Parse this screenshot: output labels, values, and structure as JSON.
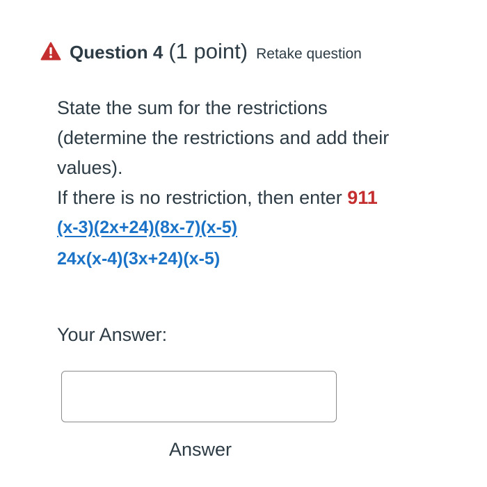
{
  "question": {
    "title": "Question 4",
    "points": "(1 point)",
    "retake_label": "Retake question",
    "icon": "warning-icon",
    "icon_color": "#c42e2e"
  },
  "prompt": {
    "line1": "State the sum for the restrictions",
    "line2": "(determine the restrictions and add their",
    "line3": "values).",
    "line4_text": "If there is no restriction, then enter ",
    "line4_number": "911",
    "number_color": "#c42e2e"
  },
  "expression": {
    "numerator": "(x-3)(2x+24)(8x-7)(x-5)",
    "denominator": "24x(x-4)(3x+24)(x-5)",
    "color": "#1b73c8"
  },
  "answer": {
    "label": "Your Answer:",
    "value": "",
    "placeholder": "",
    "button_label": "Answer"
  }
}
